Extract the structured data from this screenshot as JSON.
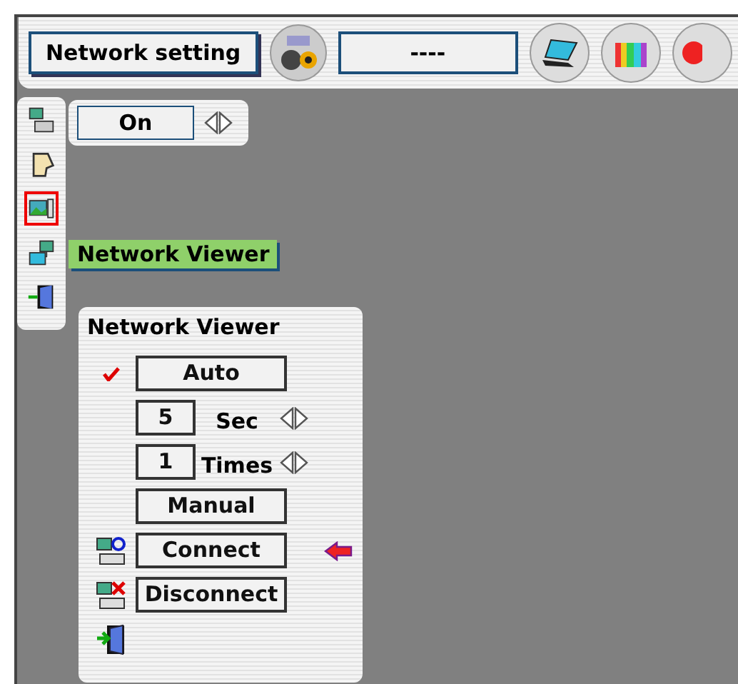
{
  "toolbar": {
    "title": "Network setting",
    "field": "----"
  },
  "sidebar": {
    "items": [
      {
        "selected": false
      },
      {
        "selected": false
      },
      {
        "selected": true
      },
      {
        "selected": false
      },
      {
        "selected": false
      }
    ]
  },
  "switch": {
    "value": "On"
  },
  "tooltip": "Network Viewer",
  "panel": {
    "title": "Network Viewer",
    "rows": [
      {
        "kind": "option",
        "label": "Auto",
        "checked": true
      },
      {
        "kind": "number",
        "value": "5",
        "unit": "Sec"
      },
      {
        "kind": "number",
        "value": "1",
        "unit": "Times"
      },
      {
        "kind": "option",
        "label": "Manual",
        "checked": false
      },
      {
        "kind": "connect",
        "label": "Connect",
        "pointer": true
      },
      {
        "kind": "disconnect",
        "label": "Disconnect",
        "pointer": false
      },
      {
        "kind": "exit"
      }
    ]
  }
}
